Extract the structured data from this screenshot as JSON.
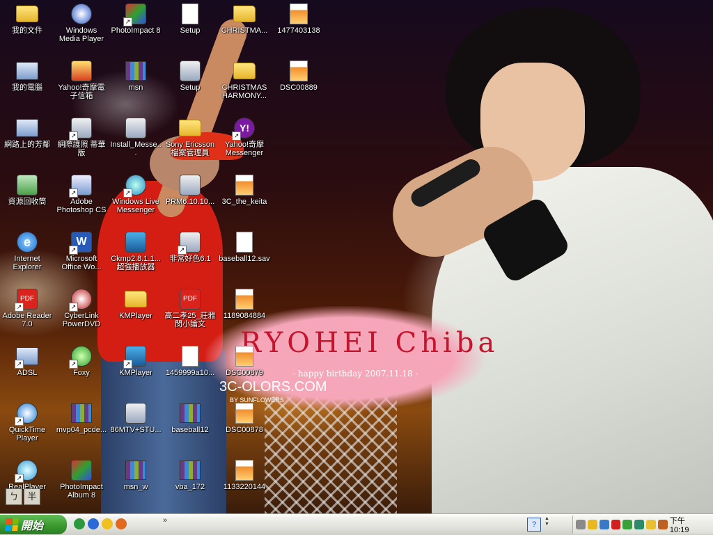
{
  "wallpaper": {
    "title": "RYOHEI Chiba",
    "subtitle": "- happy birthday 2007.11.18 -",
    "brand": "3C-OLORS.COM",
    "byline": "BY SUNFLOWERS"
  },
  "desktop_icons": [
    {
      "label": "我的文件",
      "icon": "my-documents-icon",
      "glyph": "folder",
      "shortcut": false,
      "col": 0,
      "row": 0
    },
    {
      "label": "我的電腦",
      "icon": "my-computer-icon",
      "glyph": "pc",
      "shortcut": false,
      "col": 0,
      "row": 1
    },
    {
      "label": "網路上的芳鄰",
      "icon": "network-places-icon",
      "glyph": "pc",
      "shortcut": false,
      "col": 0,
      "row": 2
    },
    {
      "label": "資源回收筒",
      "icon": "recycle-bin-icon",
      "glyph": "bin",
      "shortcut": false,
      "col": 0,
      "row": 3
    },
    {
      "label": "Internet Explorer",
      "icon": "internet-explorer-icon",
      "glyph": "ie",
      "shortcut": false,
      "col": 0,
      "row": 4
    },
    {
      "label": "Adobe Reader 7.0",
      "icon": "adobe-reader-icon",
      "glyph": "pdf",
      "shortcut": true,
      "col": 0,
      "row": 5
    },
    {
      "label": "ADSL",
      "icon": "adsl-connection-icon",
      "glyph": "pc",
      "shortcut": true,
      "col": 0,
      "row": 6
    },
    {
      "label": "QuickTime Player",
      "icon": "quicktime-icon",
      "glyph": "qt",
      "shortcut": true,
      "col": 0,
      "row": 7
    },
    {
      "label": "RealPlayer",
      "icon": "realplayer-icon",
      "glyph": "real",
      "shortcut": true,
      "col": 0,
      "row": 8
    },
    {
      "label": "Windows Media Player",
      "icon": "windows-media-player-icon",
      "glyph": "wmp",
      "shortcut": false,
      "col": 1,
      "row": 0
    },
    {
      "label": "Yahoo!奇摩電子信箱",
      "icon": "yahoo-mail-icon",
      "glyph": "mail",
      "shortcut": false,
      "col": 1,
      "row": 1
    },
    {
      "label": "網際護照 蒂華版",
      "icon": "passport-icon",
      "glyph": "app",
      "shortcut": true,
      "col": 1,
      "row": 2
    },
    {
      "label": "Adobe Photoshop CS",
      "icon": "photoshop-icon",
      "glyph": "ps",
      "shortcut": true,
      "col": 1,
      "row": 3
    },
    {
      "label": "Microsoft Office Wo...",
      "icon": "word-icon",
      "glyph": "word",
      "shortcut": true,
      "col": 1,
      "row": 4
    },
    {
      "label": "CyberLink PowerDVD",
      "icon": "powerdvd-icon",
      "glyph": "dvd",
      "shortcut": true,
      "col": 1,
      "row": 5
    },
    {
      "label": "Foxy",
      "icon": "foxy-icon",
      "glyph": "foxy",
      "shortcut": true,
      "col": 1,
      "row": 6
    },
    {
      "label": "mvp04_pcde...",
      "icon": "archive-icon",
      "glyph": "zip",
      "shortcut": false,
      "col": 1,
      "row": 7
    },
    {
      "label": "PhotoImpact Album 8",
      "icon": "photoimpact-album-icon",
      "glyph": "pi",
      "shortcut": false,
      "col": 1,
      "row": 8
    },
    {
      "label": "PhotoImpact 8",
      "icon": "photoimpact-icon",
      "glyph": "pi",
      "shortcut": true,
      "col": 2,
      "row": 0
    },
    {
      "label": "msn",
      "icon": "archive-icon",
      "glyph": "zip",
      "shortcut": false,
      "col": 2,
      "row": 1
    },
    {
      "label": "Install_Messe...",
      "icon": "installer-icon",
      "glyph": "app",
      "shortcut": false,
      "col": 2,
      "row": 2
    },
    {
      "label": "Windows Live Messenger",
      "icon": "live-messenger-icon",
      "glyph": "msn",
      "shortcut": true,
      "col": 2,
      "row": 3
    },
    {
      "label": "Ckmp2.8.1.1...超強播放器",
      "icon": "ckmp-icon",
      "glyph": "kmp",
      "shortcut": false,
      "col": 2,
      "row": 4
    },
    {
      "label": "KMPlayer",
      "icon": "folder-icon",
      "glyph": "folder",
      "shortcut": false,
      "col": 2,
      "row": 5
    },
    {
      "label": "KMPlayer",
      "icon": "kmplayer-icon",
      "glyph": "kmp",
      "shortcut": true,
      "col": 2,
      "row": 6
    },
    {
      "label": "86MTV+STU...",
      "icon": "video-file-icon",
      "glyph": "app",
      "shortcut": false,
      "col": 2,
      "row": 7
    },
    {
      "label": "msn_w",
      "icon": "archive-icon",
      "glyph": "zip",
      "shortcut": false,
      "col": 2,
      "row": 8
    },
    {
      "label": "Setup",
      "icon": "setup-icon",
      "glyph": "doc",
      "shortcut": false,
      "col": 3,
      "row": 0
    },
    {
      "label": "Setup",
      "icon": "setup-icon",
      "glyph": "app",
      "shortcut": false,
      "col": 3,
      "row": 1
    },
    {
      "label": "Sony Ericsson 檔案管理員",
      "icon": "folder-icon",
      "glyph": "folder",
      "shortcut": false,
      "col": 3,
      "row": 2
    },
    {
      "label": "PRM6.10.10...",
      "icon": "installer-icon",
      "glyph": "app",
      "shortcut": false,
      "col": 3,
      "row": 3
    },
    {
      "label": "非常好色6.1",
      "icon": "app-shortcut-icon",
      "glyph": "app",
      "shortcut": true,
      "col": 3,
      "row": 4
    },
    {
      "label": "高二孝25_莊雅閔小論文",
      "icon": "pdf-file-icon",
      "glyph": "pdf",
      "shortcut": false,
      "col": 3,
      "row": 5
    },
    {
      "label": "1459999a10...",
      "icon": "image-file-icon",
      "glyph": "doc",
      "shortcut": false,
      "col": 3,
      "row": 6
    },
    {
      "label": "baseball12",
      "icon": "archive-icon",
      "glyph": "zip",
      "shortcut": false,
      "col": 3,
      "row": 7
    },
    {
      "label": "vba_172",
      "icon": "archive-icon",
      "glyph": "zip",
      "shortcut": false,
      "col": 3,
      "row": 8
    },
    {
      "label": "CHRISTMA...",
      "icon": "folder-icon",
      "glyph": "folder",
      "shortcut": false,
      "col": 4,
      "row": 0
    },
    {
      "label": "CHRISTMAS HARMONY...",
      "icon": "folder-icon",
      "glyph": "folder",
      "shortcut": false,
      "col": 4,
      "row": 1
    },
    {
      "label": "Yahoo!奇摩 Messenger",
      "icon": "yahoo-messenger-icon",
      "glyph": "yahoo",
      "shortcut": true,
      "col": 4,
      "row": 2
    },
    {
      "label": "3C_the_keita",
      "icon": "image-file-icon",
      "glyph": "img",
      "shortcut": false,
      "col": 4,
      "row": 3
    },
    {
      "label": "baseball12.sav",
      "icon": "save-file-icon",
      "glyph": "doc",
      "shortcut": false,
      "col": 4,
      "row": 4
    },
    {
      "label": "1189084884",
      "icon": "image-file-icon",
      "glyph": "img",
      "shortcut": false,
      "col": 4,
      "row": 5
    },
    {
      "label": "DSC00879",
      "icon": "image-file-icon",
      "glyph": "img",
      "shortcut": false,
      "col": 4,
      "row": 6
    },
    {
      "label": "DSC00878",
      "icon": "image-file-icon",
      "glyph": "img",
      "shortcut": false,
      "col": 4,
      "row": 7
    },
    {
      "label": "1133220144",
      "icon": "image-file-icon",
      "glyph": "img",
      "shortcut": false,
      "col": 4,
      "row": 8
    },
    {
      "label": "1477403138",
      "icon": "image-file-icon",
      "glyph": "img",
      "shortcut": false,
      "col": 5,
      "row": 0
    },
    {
      "label": "DSC00889",
      "icon": "image-file-icon",
      "glyph": "img",
      "shortcut": false,
      "col": 5,
      "row": 1
    }
  ],
  "ime_bar": {
    "key1": "ㄅ",
    "key2": "半"
  },
  "taskbar": {
    "start_label": "開始",
    "quick_launch": [
      {
        "icon": "media-player-quick-icon",
        "color": "#2c9a3c"
      },
      {
        "icon": "messenger-quick-icon",
        "color": "#2a6ad8"
      },
      {
        "icon": "yahoo-quick-icon",
        "color": "#f0c020"
      },
      {
        "icon": "firefox-quick-icon",
        "color": "#e06a20"
      }
    ],
    "chevron": "»",
    "language_indicator": "?",
    "tray_icons": [
      {
        "icon": "tray-expand-icon",
        "color": "#8a8a8a"
      },
      {
        "icon": "security-shield-icon",
        "color": "#e8b820"
      },
      {
        "icon": "network-icon",
        "color": "#3a78c8"
      },
      {
        "icon": "antivirus-icon",
        "color": "#d02020"
      },
      {
        "icon": "update-icon",
        "color": "#3aa03a"
      },
      {
        "icon": "messenger-tray-icon",
        "color": "#2a8a6a"
      },
      {
        "icon": "yahoo-tray-icon",
        "color": "#e8c030"
      },
      {
        "icon": "volume-icon",
        "color": "#c06020"
      }
    ],
    "clock": "下午 10:19"
  },
  "colors": {
    "start_green": "#3a9a2f",
    "taskbar": "#e3e3dd",
    "wallpaper_pink": "#f5a7b9",
    "title_red": "#c4142e"
  }
}
